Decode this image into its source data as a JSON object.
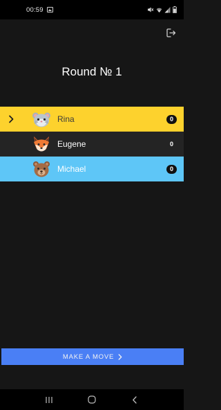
{
  "status_bar": {
    "time": "00:59",
    "icons": [
      "gallery-icon",
      "mute-icon",
      "wifi-icon",
      "signal-icon",
      "battery-icon"
    ]
  },
  "header": {
    "title": "Round № 1",
    "logout_icon": "logout-icon"
  },
  "players": [
    {
      "name": "Rina",
      "score": "0",
      "avatar": "hamster-avatar",
      "state": "active",
      "bg_color": "#fdd22d",
      "current_turn": true
    },
    {
      "name": "Eugene",
      "score": "0",
      "avatar": "fox-avatar",
      "state": "normal",
      "bg_color": "#242424",
      "current_turn": false
    },
    {
      "name": "Michael",
      "score": "0",
      "avatar": "bear-avatar",
      "state": "highlight",
      "bg_color": "#5ec6f7",
      "current_turn": false
    }
  ],
  "actions": {
    "make_move_label": "MAKE A MOVE",
    "button_color": "#4a7ff5"
  },
  "nav_bar": {
    "buttons": [
      "recent-apps-icon",
      "home-icon",
      "back-icon"
    ]
  }
}
